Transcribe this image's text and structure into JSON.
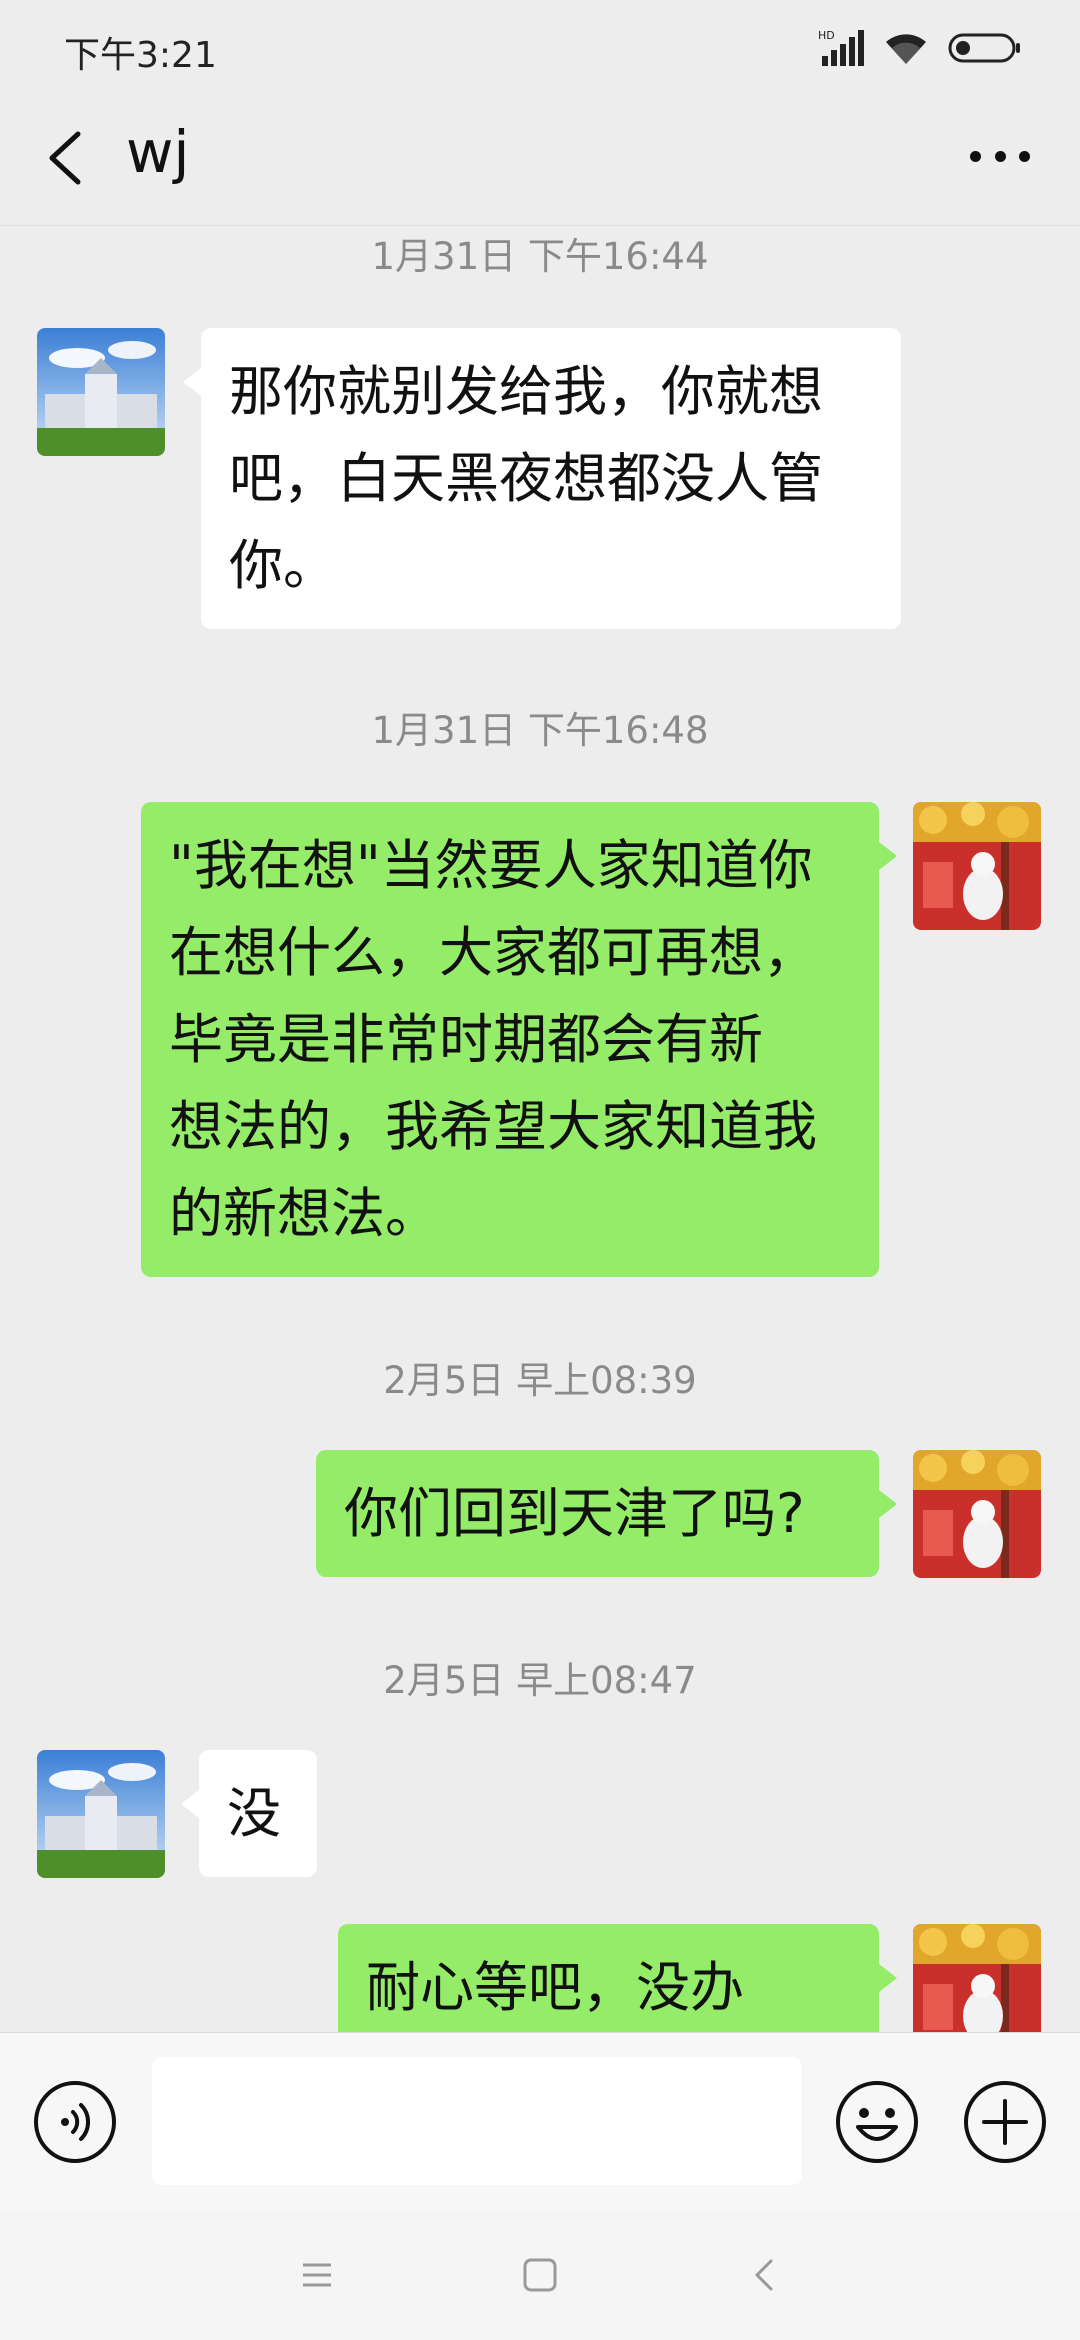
{
  "status_bar": {
    "time": "下午3:21",
    "network_label": "HD"
  },
  "header": {
    "title": "wj"
  },
  "messages": [
    {
      "type": "timestamp",
      "text": "1月31日 下午16:44"
    },
    {
      "type": "message",
      "direction": "in",
      "lines": [
        "那你就别发给我，你就想",
        "吧，白天黑夜想都没人管",
        "你。"
      ]
    },
    {
      "type": "timestamp",
      "text": "1月31日 下午16:48"
    },
    {
      "type": "message",
      "direction": "out",
      "lines": [
        "\"我在想\"当然要人家知道你",
        "在想什么，大家都可再想，",
        "毕竟是非常时期都会有新",
        "想法的，我希望大家知道我",
        "的新想法。"
      ]
    },
    {
      "type": "timestamp",
      "text": "2月5日 早上08:39"
    },
    {
      "type": "message",
      "direction": "out",
      "lines": [
        "你们回到天津了吗?"
      ]
    },
    {
      "type": "timestamp",
      "text": "2月5日 早上08:47"
    },
    {
      "type": "message",
      "direction": "in",
      "lines": [
        "没"
      ]
    },
    {
      "type": "message",
      "direction": "out",
      "lines": [
        "耐心等吧，没办法。"
      ]
    }
  ],
  "colors": {
    "background": "#ededed",
    "bubble_out": "#95ec69",
    "bubble_in": "#ffffff",
    "timestamp_text": "#8a8a8a"
  },
  "input_bar": {
    "icons": [
      "voice-icon",
      "emoji-icon",
      "plus-icon"
    ],
    "text_value": ""
  },
  "system_nav": {
    "icons": [
      "menu-icon",
      "home-icon",
      "back-icon"
    ]
  }
}
